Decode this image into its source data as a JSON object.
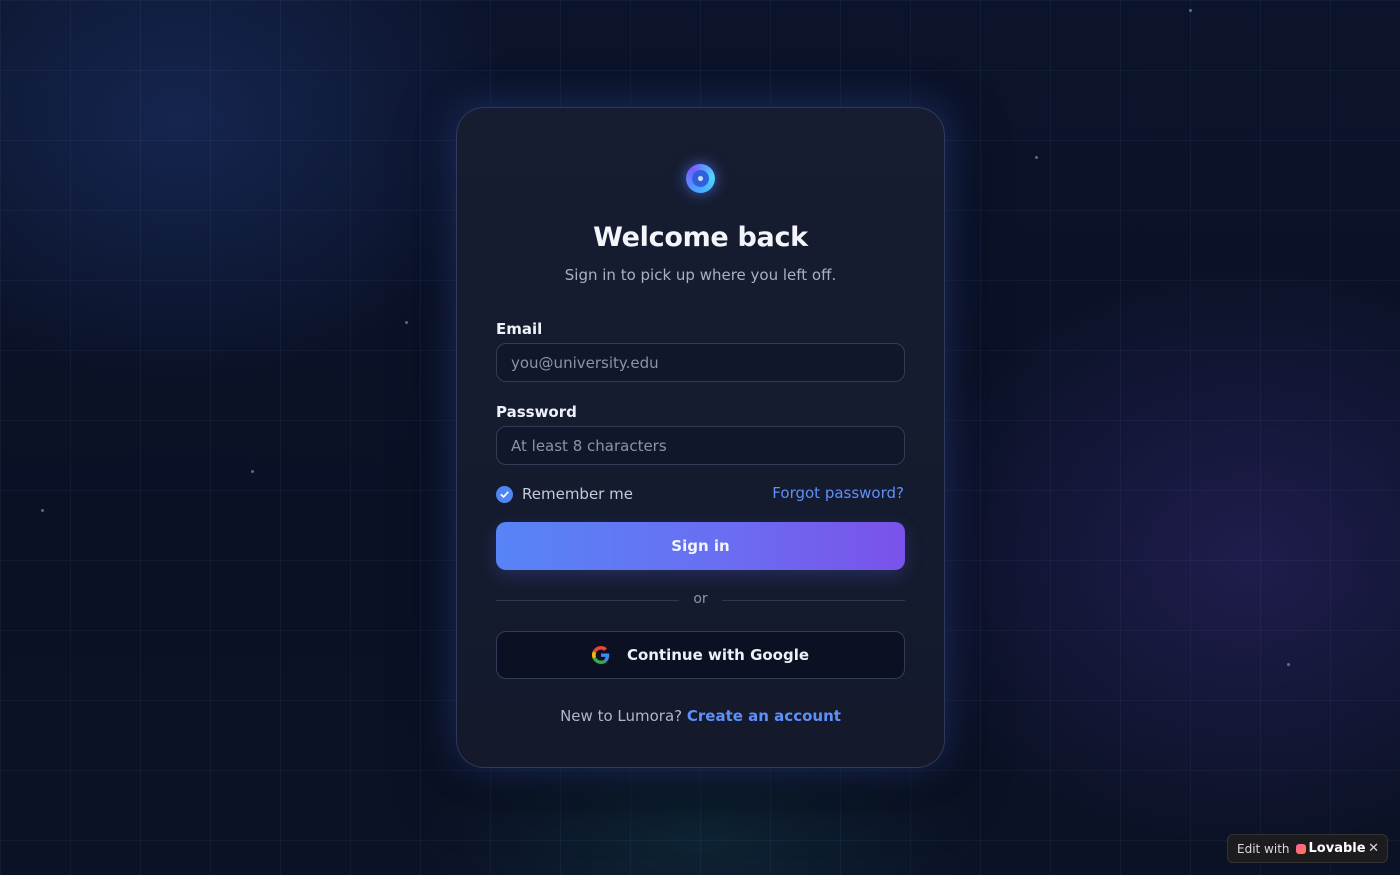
{
  "login": {
    "title": "Welcome back",
    "subtitle": "Sign in to pick up where you left off.",
    "email": {
      "label": "Email",
      "placeholder": "you@university.edu",
      "value": ""
    },
    "password": {
      "label": "Password",
      "placeholder": "At least 8 characters",
      "value": ""
    },
    "remember_label": "Remember me",
    "remember_checked": true,
    "forgot_label": "Forgot password?",
    "signin_label": "Sign in",
    "divider_label": "or",
    "google_label": "Continue with Google",
    "footer_text": "New to Lumora?",
    "footer_link": "Create an account"
  },
  "badge": {
    "prefix": "Edit with",
    "brand": "Lovable",
    "close": "✕"
  },
  "colors": {
    "accent": "#5f8ff8",
    "button_start": "#5784f6",
    "button_end": "#7a52ea",
    "card_bg": "#161d31",
    "page_bg": "#0a1022"
  },
  "icons": {
    "logo": "orb-logo-icon",
    "checkbox": "check-icon",
    "google": "google-icon",
    "close": "close-icon"
  }
}
